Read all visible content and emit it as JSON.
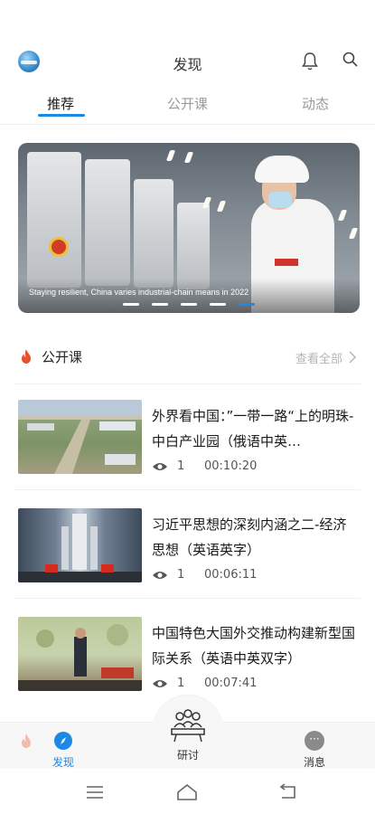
{
  "header": {
    "title": "发现"
  },
  "tabs": [
    {
      "label": "推荐",
      "active": true
    },
    {
      "label": "公开课",
      "active": false
    },
    {
      "label": "动态",
      "active": false
    }
  ],
  "banner": {
    "caption": "Staying resilient, China varies industrial-chain means in 2022",
    "slide_count": 5,
    "active_slide": 5
  },
  "section": {
    "title": "公开课",
    "view_all": "查看全部"
  },
  "courses": [
    {
      "title": "外界看中国：”一带一路“上的明珠-中白产业园（俄语中英…",
      "views": "1",
      "duration": "00:10:20"
    },
    {
      "title": "习近平思想的深刻内涵之二-经济思想（英语英字）",
      "views": "1",
      "duration": "00:06:11"
    },
    {
      "title": "中国特色大国外交推动构建新型国际关系（英语中英双字）",
      "views": "1",
      "duration": "00:07:41"
    }
  ],
  "bottom_nav": {
    "discover": "发现",
    "center": "研讨",
    "messages": "消息"
  },
  "colors": {
    "accent": "#1e88e5",
    "fire": "#e8522b"
  }
}
